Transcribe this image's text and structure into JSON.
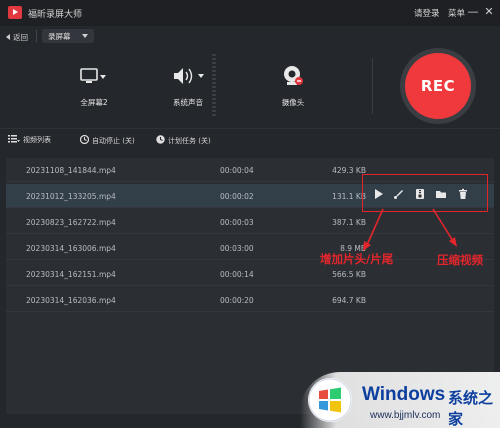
{
  "app": {
    "title": "福昕录屏大师",
    "login_label": "请登录",
    "menu_label": "菜单"
  },
  "window_controls": {
    "minimize": "—",
    "close": "✕"
  },
  "subbar": {
    "back_label": "返回",
    "mode_value": "录屏幕"
  },
  "controls": {
    "screen_label": "全屏幕2",
    "audio_label": "系统声音",
    "camera_label": "摄像头",
    "rec_label": "REC"
  },
  "toolbar": {
    "video_list_label": "视频列表",
    "auto_stop_label": "自动停止 (关)",
    "schedule_label": "计划任务 (关)"
  },
  "files": [
    {
      "name": "20231108_141844.mp4",
      "duration": "00:00:04",
      "size": "429.3 KB"
    },
    {
      "name": "20231012_133205.mp4",
      "duration": "00:00:02",
      "size": "131.1 KB"
    },
    {
      "name": "20230823_162722.mp4",
      "duration": "00:00:03",
      "size": "387.1 KB"
    },
    {
      "name": "20230314_163006.mp4",
      "duration": "00:03:00",
      "size": "8.9 MB"
    },
    {
      "name": "20230314_162151.mp4",
      "duration": "00:00:14",
      "size": "566.5 KB"
    },
    {
      "name": "20230314_162036.mp4",
      "duration": "00:00:20",
      "size": "694.7 KB"
    }
  ],
  "annotations": {
    "intro_outro": "增加片头/片尾",
    "compress": "压缩视频"
  },
  "icons": [
    "app-logo-icon",
    "monitor-icon",
    "speaker-icon",
    "camera-icon",
    "list-icon",
    "clock-icon",
    "schedule-icon",
    "play-icon",
    "edit-icon",
    "compress-icon",
    "folder-icon",
    "delete-icon",
    "windows-logo-icon"
  ],
  "watermark": {
    "brand": "Windows",
    "brand_cn": "系统之家",
    "url": "www.bjjmlv.com"
  },
  "colors": {
    "accent": "#f0393c",
    "annotation": "#e3262c",
    "background": "#24272b",
    "selected_row": "#323e48"
  }
}
